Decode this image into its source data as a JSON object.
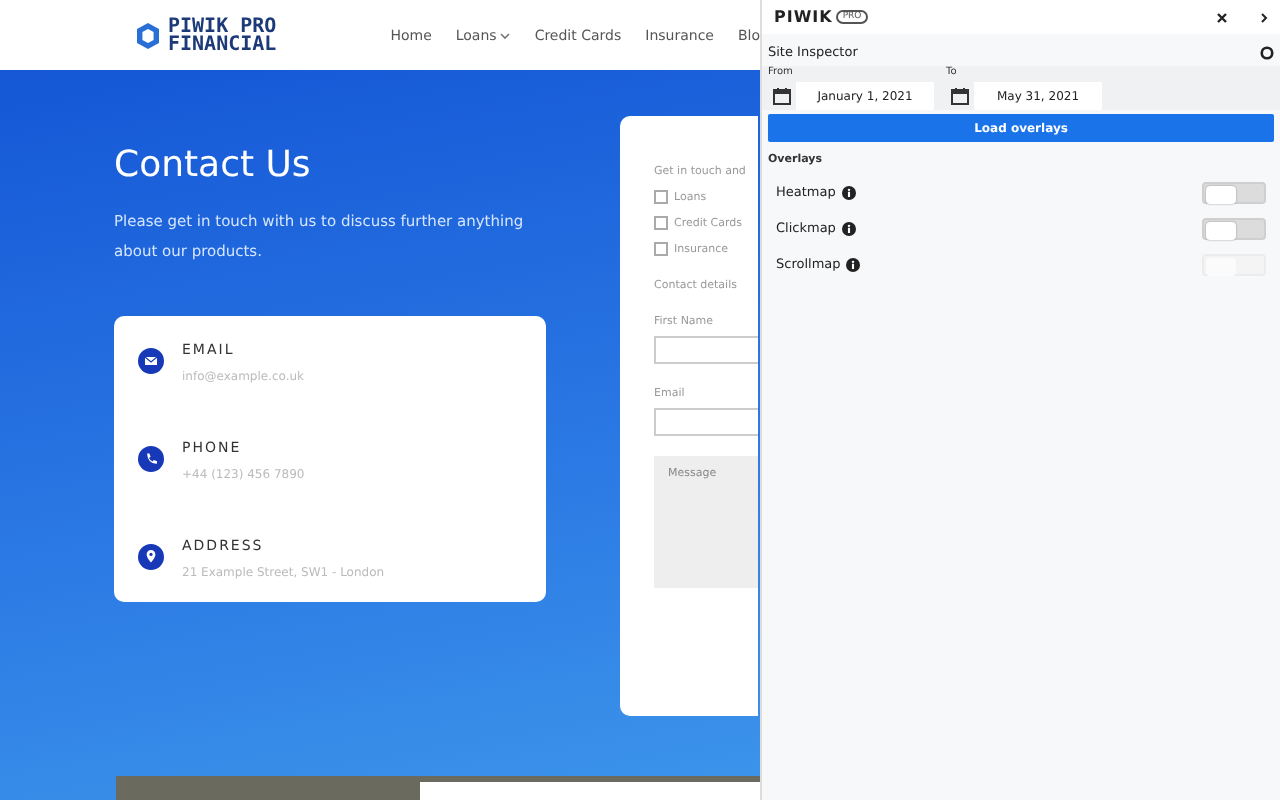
{
  "site": {
    "logo_line_1": "PIWIK PRO",
    "logo_line_2": "FINANCIAL",
    "nav": [
      {
        "label": "Home",
        "dropdown": false
      },
      {
        "label": "Loans",
        "dropdown": true
      },
      {
        "label": "Credit Cards",
        "dropdown": false
      },
      {
        "label": "Insurance",
        "dropdown": false
      },
      {
        "label": "Blo",
        "dropdown": false
      }
    ],
    "heading": "Contact Us",
    "intro": "Please get in touch with us to discuss further anything about our products.",
    "contacts": [
      {
        "kind": "email",
        "label": "EMAIL",
        "value": "info@example.co.uk"
      },
      {
        "kind": "phone",
        "label": "PHONE",
        "value": "+44 (123) 456 7890"
      },
      {
        "kind": "address",
        "label": "ADDRESS",
        "value": "21 Example Street, SW1 - London"
      }
    ],
    "form": {
      "prompt": "Get in touch and",
      "options": [
        {
          "label": "Loans",
          "checked": false
        },
        {
          "label": "Credit Cards",
          "checked": false
        },
        {
          "label": "Insurance",
          "checked": false
        }
      ],
      "details_label": "Contact details",
      "first_name_label": "First Name",
      "email_label": "Email",
      "message_placeholder": "Message"
    }
  },
  "panel": {
    "brand": "PIWIK",
    "badge": "PRO",
    "section": "Site Inspector",
    "from_label": "From",
    "from_value": "January 1, 2021",
    "to_label": "To",
    "to_value": "May 31, 2021",
    "load_button": "Load overlays",
    "overlays_label": "Overlays",
    "overlays": [
      {
        "label": "Heatmap",
        "on": false,
        "disabled": false
      },
      {
        "label": "Clickmap",
        "on": false,
        "disabled": false
      },
      {
        "label": "Scrollmap",
        "on": false,
        "disabled": true
      }
    ]
  }
}
